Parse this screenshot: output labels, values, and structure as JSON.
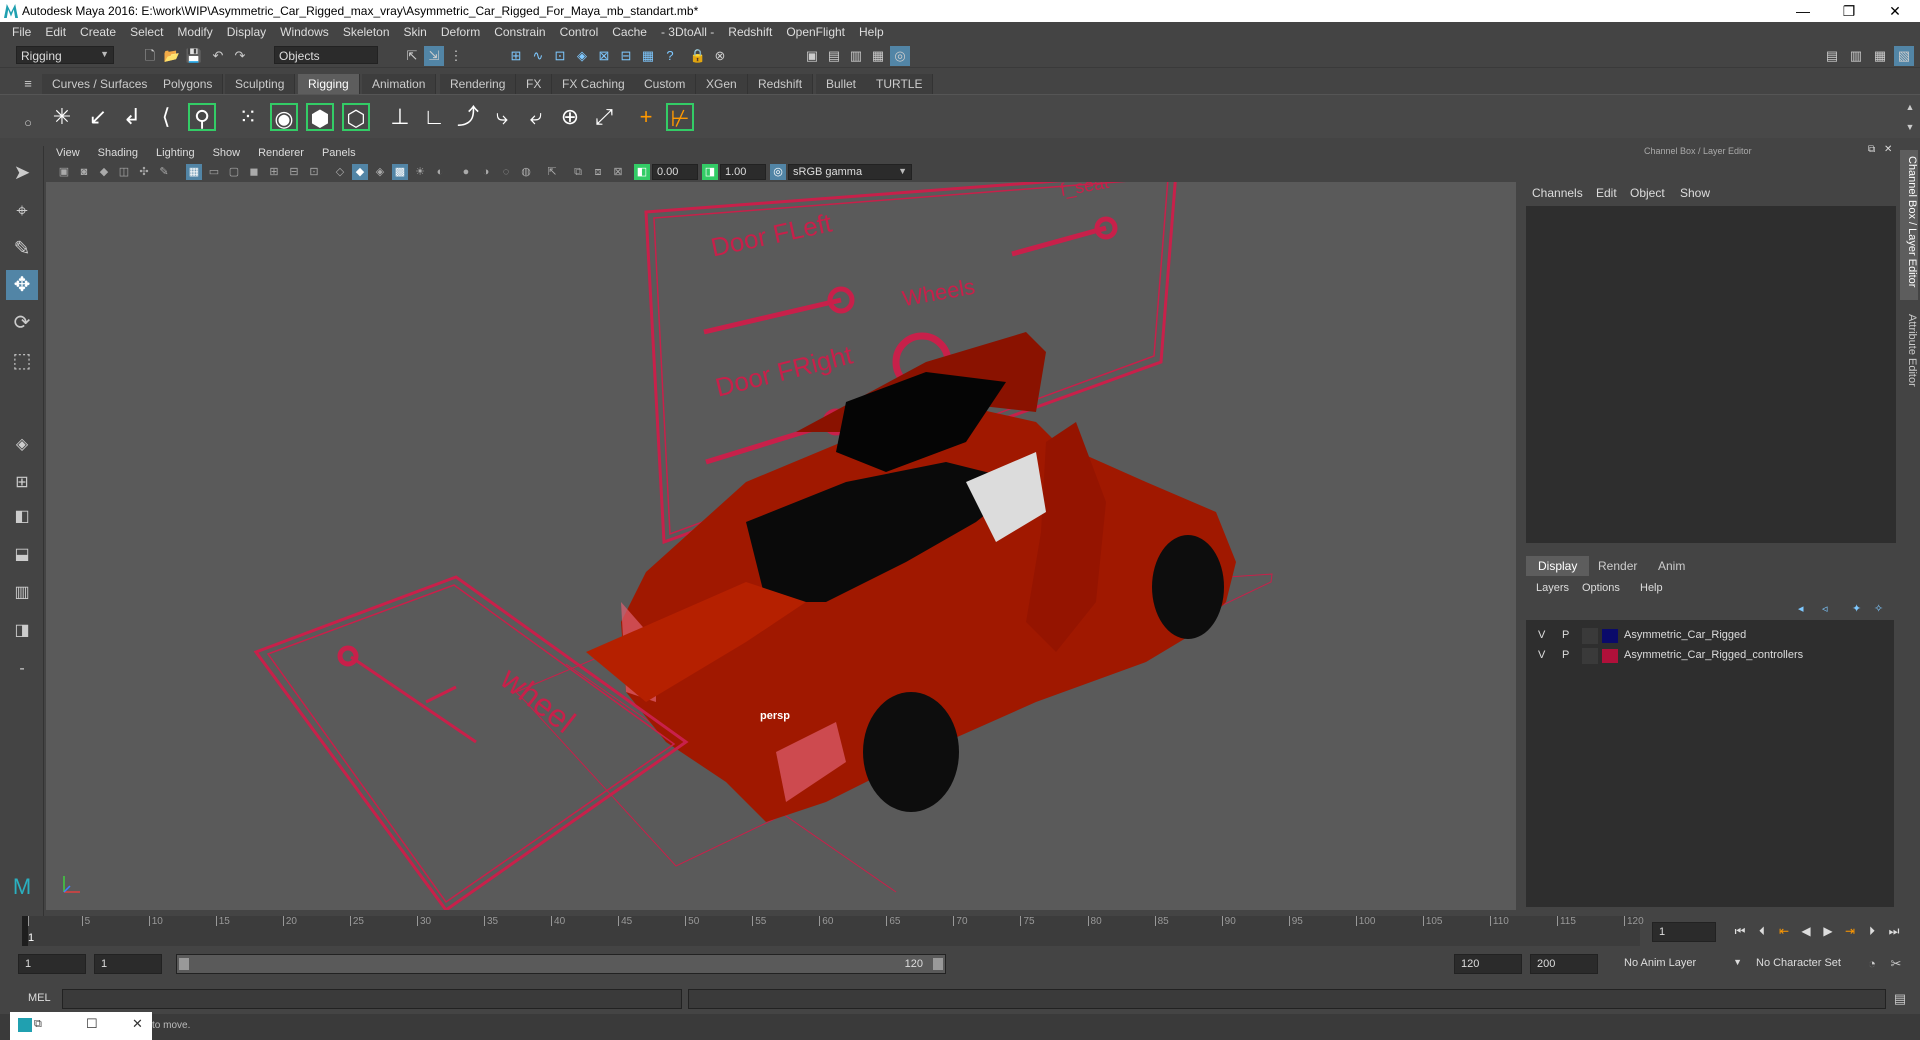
{
  "window": {
    "title": "Autodesk Maya 2016: E:\\work\\WIP\\Asymmetric_Car_Rigged_max_vray\\Asymmetric_Car_Rigged_For_Maya_mb_standart.mb*",
    "minimize": "—",
    "restore": "❐",
    "close": "✕"
  },
  "menu": [
    "File",
    "Edit",
    "Create",
    "Select",
    "Modify",
    "Display",
    "Windows",
    "Skeleton",
    "Skin",
    "Deform",
    "Constrain",
    "Control",
    "Cache",
    "- 3DtoAll -",
    "Redshift",
    "OpenFlight",
    "Help"
  ],
  "status_line": {
    "mode": "Rigging",
    "selection_mask": "Objects"
  },
  "shelf_tabs": [
    "Curves / Surfaces",
    "Polygons",
    "Sculpting",
    "Rigging",
    "Animation",
    "Rendering",
    "FX",
    "FX Caching",
    "Custom",
    "XGen",
    "Redshift",
    "Bullet",
    "TURTLE"
  ],
  "shelf_active": "Rigging",
  "viewport": {
    "menu": [
      "View",
      "Shading",
      "Lighting",
      "Show",
      "Renderer",
      "Panels"
    ],
    "exposure": "0.00",
    "gamma": "1.00",
    "colorspace": "sRGB gamma",
    "camera_label": "persp",
    "scene_labels": {
      "door_fleft": "Door FLeft",
      "door_fright": "Door FRight",
      "wheels": "Wheels",
      "f_seat": "f_seat",
      "wheel": "wheel"
    }
  },
  "right_panel": {
    "header": "Channel Box / Layer Editor",
    "channel_menu": [
      "Channels",
      "Edit",
      "Object",
      "Show"
    ],
    "layer_tabs": [
      "Display",
      "Render",
      "Anim"
    ],
    "layer_active": "Display",
    "layer_menu": [
      "Layers",
      "Options",
      "Help"
    ],
    "layers": [
      {
        "v": "V",
        "p": "P",
        "name": "Asymmetric_Car_Rigged",
        "color": "#0a0a6a"
      },
      {
        "v": "V",
        "p": "P",
        "name": "Asymmetric_Car_Rigged_controllers",
        "color": "#b0103a"
      }
    ],
    "side_tabs": [
      "Channel Box / Layer Editor",
      "Attribute Editor"
    ]
  },
  "timeline": {
    "ticks": [
      1,
      5,
      10,
      15,
      20,
      25,
      30,
      35,
      40,
      45,
      50,
      55,
      60,
      65,
      70,
      75,
      80,
      85,
      90,
      95,
      100,
      105,
      110,
      115,
      120
    ],
    "current_frame": "1"
  },
  "range": {
    "start": "1",
    "playback_start": "1",
    "slider_start": "1",
    "slider_end": "120",
    "playback_end": "120",
    "end": "200",
    "anim_layer": "No Anim Layer",
    "character_set": "No Character Set"
  },
  "command_line": {
    "language": "MEL"
  },
  "help_line": {
    "text": "to move."
  },
  "colors": {
    "accent": "#5285a6",
    "rig_curve": "#c8204a",
    "car_body": "#a01800"
  }
}
